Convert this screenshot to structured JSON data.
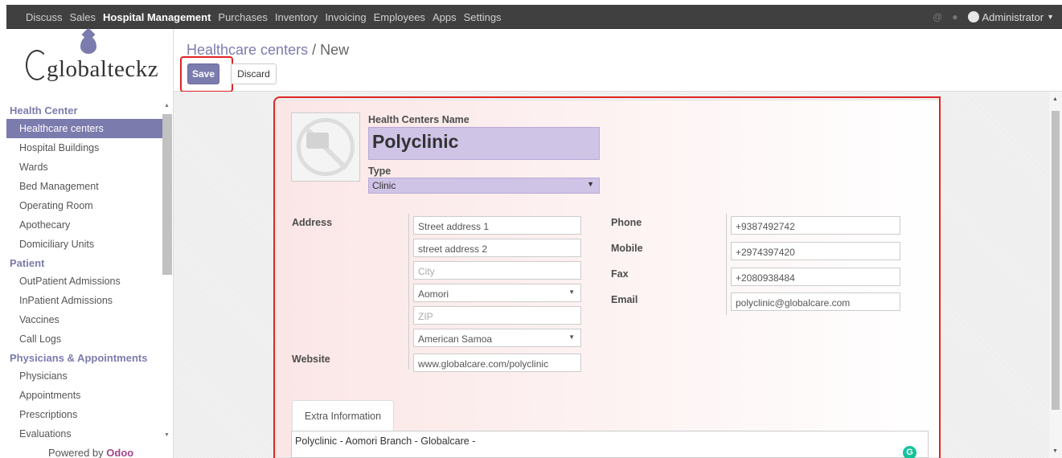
{
  "topbar": {
    "menu": [
      "Discuss",
      "Sales",
      "Hospital Management",
      "Purchases",
      "Inventory",
      "Invoicing",
      "Employees",
      "Apps",
      "Settings"
    ],
    "active_menu": "Hospital Management",
    "user": "Administrator"
  },
  "logo": {
    "text": "globalteckz"
  },
  "sidebar": {
    "sections": [
      {
        "title": "Health Center",
        "items": [
          "Healthcare centers",
          "Hospital Buildings",
          "Wards",
          "Bed Management",
          "Operating Room",
          "Apothecary",
          "Domiciliary Units"
        ]
      },
      {
        "title": "Patient",
        "items": [
          "OutPatient Admissions",
          "InPatient Admissions",
          "Vaccines",
          "Call Logs"
        ]
      },
      {
        "title": "Physicians & Appointments",
        "items": [
          "Physicians",
          "Appointments",
          "Prescriptions",
          "Evaluations"
        ]
      }
    ],
    "selected": "Healthcare centers",
    "powered_by": "Powered by",
    "powered_brand": "Odoo"
  },
  "control_panel": {
    "breadcrumb_parent": "Healthcare centers",
    "breadcrumb_sep": " / ",
    "breadcrumb_current": "New",
    "save_label": "Save",
    "discard_label": "Discard"
  },
  "form": {
    "name_label": "Health Centers Name",
    "name_value": "Polyclinic",
    "type_label": "Type",
    "type_value": "Clinic",
    "address_label": "Address",
    "street1": "Street address 1",
    "street2": "street address 2",
    "city_placeholder": "City",
    "state": "Aomori",
    "zip_placeholder": "ZIP",
    "country": "American Samoa",
    "website_label": "Website",
    "website_value": "www.globalcare.com/polyclinic",
    "phone_label": "Phone",
    "phone_value": "+9387492742",
    "mobile_label": "Mobile",
    "mobile_value": "+2974397420",
    "fax_label": "Fax",
    "fax_value": "+2080938484",
    "email_label": "Email",
    "email_value": "polyclinic@globalcare.com",
    "tab_label": "Extra Information",
    "notes_value": "Polyclinic - Aomori Branch - Globalcare -"
  },
  "colors": {
    "brand": "#7c7bad",
    "highlight": "#e02424",
    "field_bg": "#cfc3e6"
  }
}
